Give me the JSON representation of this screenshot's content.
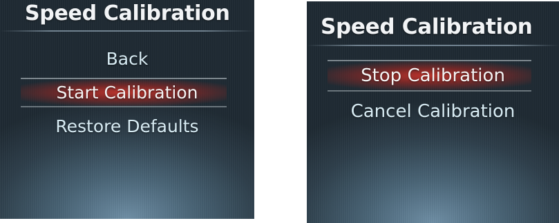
{
  "left_screen": {
    "title": "Speed Calibration",
    "items": [
      {
        "label": "Back",
        "selected": false
      },
      {
        "label": "Start Calibration",
        "selected": true
      },
      {
        "label": "Restore Defaults",
        "selected": false
      }
    ]
  },
  "right_screen": {
    "title": "Speed Calibration",
    "items": [
      {
        "label": "Stop Calibration",
        "selected": true
      },
      {
        "label": "Cancel Calibration",
        "selected": false
      }
    ]
  },
  "colors": {
    "highlight": "#c4342c",
    "text": "#d8ecf4",
    "background": "#26323c"
  }
}
